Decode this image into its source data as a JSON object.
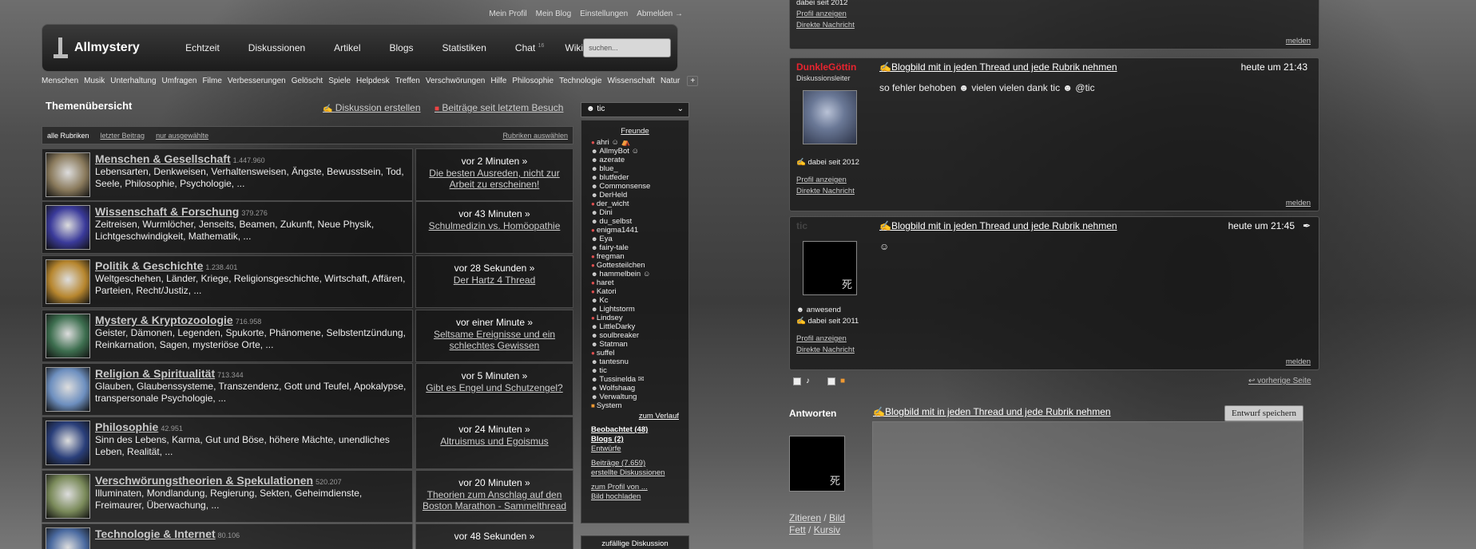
{
  "left": {
    "toplinks": [
      "Mein Profil",
      "Mein Blog",
      "Einstellungen",
      "Abmelden →"
    ],
    "logo": "Allmystery",
    "nav": [
      "Echtzeit",
      "Diskussionen",
      "Artikel",
      "Blogs",
      "Statistiken",
      "Chat",
      "Wiki"
    ],
    "chat_count": "16",
    "search_placeholder": "suchen...",
    "categories_bar": [
      "Menschen",
      "Musik",
      "Unterhaltung",
      "Umfragen",
      "Filme",
      "Verbesserungen",
      "Gelöscht",
      "Spiele",
      "Helpdesk",
      "Treffen",
      "Verschwörungen",
      "Hilfe",
      "Philosophie",
      "Technologie",
      "Wissenschaft",
      "Natur"
    ],
    "plus": "+",
    "heading": "Themenübersicht",
    "create_discussion": "Diskussion erstellen",
    "posts_since": "Beiträge seit letztem Besuch",
    "filter": {
      "all": "alle Rubriken",
      "last": "letzter Beitrag",
      "selected": "nur ausgewählte",
      "choose": "Rubriken auswählen"
    },
    "categories": [
      {
        "title": "Menschen & Gesellschaft",
        "count": "1.447.960",
        "desc": "Lebensarten, Denkweisen, Verhaltensweisen, Ängste, Bewusstsein, Tod, Seele, Philosophie, Psychologie, ...",
        "time": "vor 2 Minuten »",
        "link": "Die besten Ausreden, nicht zur Arbeit zu erscheinen!",
        "color": "#8a7a5c"
      },
      {
        "title": "Wissenschaft & Forschung",
        "count": "379.276",
        "desc": "Zeitreisen, Wurmlöcher, Jenseits, Beamen, Zukunft, Neue Physik, Lichtgeschwindigkeit, Mathematik, ...",
        "time": "vor 43 Minuten »",
        "link": "Schulmedizin vs. Homöopathie",
        "color": "#3a3a9a"
      },
      {
        "title": "Politik & Geschichte",
        "count": "1.238.401",
        "desc": "Weltgeschehen, Länder, Kriege, Religionsgeschichte, Wirtschaft, Affären, Parteien, Recht/Justiz, ...",
        "time": "vor 28 Sekunden »",
        "link": "Der Hartz 4 Thread",
        "color": "#b7862e"
      },
      {
        "title": "Mystery & Kryptozoologie",
        "count": "716.958",
        "desc": "Geister, Dämonen, Legenden, Spukorte, Phänomene, Selbstentzündung, Reinkarnation, Sagen, mysteriöse Orte, ...",
        "time": "vor einer Minute »",
        "link": "Seltsame Ereignisse und ein schlechtes Gewissen",
        "color": "#3d6e4f"
      },
      {
        "title": "Religion & Spiritualität",
        "count": "713.344",
        "desc": "Glauben, Glaubenssysteme, Transzendenz, Gott und Teufel, Apokalypse, transpersonale Psychologie, ...",
        "time": "vor 5 Minuten »",
        "link": "Gibt es Engel und Schutzengel?",
        "color": "#6d8fbf"
      },
      {
        "title": "Philosophie",
        "count": "42.951",
        "desc": "Sinn des Lebens, Karma, Gut und Böse, höhere Mächte, unendliches Leben, Realität, ...",
        "time": "vor 24 Minuten »",
        "link": "Altruismus und Egoismus",
        "color": "#2a3f7a"
      },
      {
        "title": "Verschwörungstheorien & Spekulationen",
        "count": "520.207",
        "desc": "Illuminaten, Mondlandung, Regierung, Sekten, Geheimdienste, Freimaurer, Überwachung, ...",
        "time": "vor 20 Minuten »",
        "link": "Theorien zum Anschlag auf den Boston Marathon - Sammelthread",
        "color": "#7a8a5a"
      },
      {
        "title": "Technologie & Internet",
        "count": "80.106",
        "desc": "",
        "time": "vor 48 Sekunden »",
        "link": "",
        "color": "#4a6aa0"
      }
    ],
    "friend_select": "tic",
    "friends_heading": "Freunde",
    "friends": [
      {
        "n": "ahri",
        "s": "on",
        "x": "☺ ⛺"
      },
      {
        "n": "AllmyBot",
        "s": "bot",
        "x": "☺"
      },
      {
        "n": "azerate",
        "s": "ok",
        "x": ""
      },
      {
        "n": "blue_",
        "s": "ok",
        "x": ""
      },
      {
        "n": "blutfeder",
        "s": "ok",
        "x": ""
      },
      {
        "n": "Commonsense",
        "s": "ok",
        "x": ""
      },
      {
        "n": "DerHeld",
        "s": "ok",
        "x": ""
      },
      {
        "n": "der_wicht",
        "s": "on",
        "x": ""
      },
      {
        "n": "Dini",
        "s": "ok",
        "x": ""
      },
      {
        "n": "du_selbst",
        "s": "ok",
        "x": ""
      },
      {
        "n": "enigma1441",
        "s": "on",
        "x": ""
      },
      {
        "n": "Eya",
        "s": "ok",
        "x": ""
      },
      {
        "n": "fairy-tale",
        "s": "ok",
        "x": ""
      },
      {
        "n": "fregman",
        "s": "on",
        "x": ""
      },
      {
        "n": "Gottesteilchen",
        "s": "on",
        "x": ""
      },
      {
        "n": "hammelbein",
        "s": "ok",
        "x": "☺"
      },
      {
        "n": "haret",
        "s": "on",
        "x": ""
      },
      {
        "n": "Katori",
        "s": "on",
        "x": ""
      },
      {
        "n": "Kc",
        "s": "ok",
        "x": ""
      },
      {
        "n": "Lightstorm",
        "s": "ok",
        "x": ""
      },
      {
        "n": "Lindsey",
        "s": "on",
        "x": ""
      },
      {
        "n": "LittleDarky",
        "s": "ok",
        "x": ""
      },
      {
        "n": "soulbreaker",
        "s": "ok",
        "x": ""
      },
      {
        "n": "Statman",
        "s": "ok",
        "x": ""
      },
      {
        "n": "suffel",
        "s": "on",
        "x": ""
      },
      {
        "n": "tantesnu",
        "s": "ok",
        "x": ""
      },
      {
        "n": "tic",
        "s": "ok",
        "x": ""
      },
      {
        "n": "Tussinelda",
        "s": "ok",
        "x": "✉"
      },
      {
        "n": "Wolfshaag",
        "s": "ok",
        "x": ""
      },
      {
        "n": "Verwaltung",
        "s": "ok",
        "x": ""
      },
      {
        "n": "System",
        "s": "sys",
        "x": ""
      }
    ],
    "history": "zum Verlauf",
    "stats": [
      {
        "t": "Beobachtet (48)",
        "b": true
      },
      {
        "t": "Blogs (2)",
        "b": true
      },
      {
        "t": "Entwürfe",
        "b": false
      }
    ],
    "stats2": [
      "Beiträge (7.659)",
      "erstellte Diskussionen"
    ],
    "stats3": [
      "zum Profil von ...",
      "Bild hochladen"
    ],
    "random": "zufällige Diskussion"
  },
  "right": {
    "p0": {
      "profile": "Profil anzeigen",
      "message": "Direkte Nachricht",
      "report": "melden",
      "since": "dabei seit 2012"
    },
    "p1": {
      "user": "DunkleGöttin",
      "role": "Diskussionsleiter",
      "title": "Blogbild mit in jeden Thread und jede Rubrik nehmen",
      "date": "heute um 21:43",
      "body": "so fehler behoben ☻ vielen vielen dank tic ☻ @tic",
      "since": "dabei seit 2012",
      "profile": "Profil anzeigen",
      "message": "Direkte Nachricht",
      "report": "melden",
      "ucolor": "#e8242f"
    },
    "p2": {
      "user": "tic",
      "title": "Blogbild mit in jeden Thread und jede Rubrik nehmen",
      "date": "heute um 21:45",
      "body": "☺",
      "status": "anwesend",
      "since": "dabei seit 2011",
      "profile": "Profil anzeigen",
      "message": "Direkte Nachricht",
      "report": "melden",
      "avatar_char": "死"
    },
    "prev_page": "vorherige Seite",
    "reply_heading": "Antworten",
    "reply_title": "Blogbild mit in jeden Thread und jede Rubrik nehmen",
    "draft": "Entwurf speichern",
    "fmt": {
      "quote": "Zitieren",
      "image": "Bild",
      "bold": "Fett",
      "italic": "Kursiv"
    },
    "avatar_char": "死"
  }
}
